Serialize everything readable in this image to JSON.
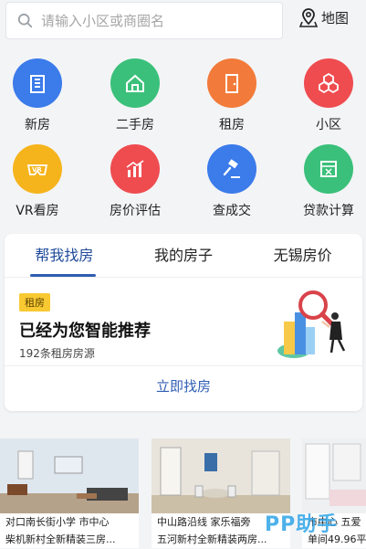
{
  "search": {
    "placeholder": "请输入小区或商圈名"
  },
  "map": {
    "label": "地图"
  },
  "categories": [
    {
      "label": "新房",
      "color": "#3b7bea"
    },
    {
      "label": "二手房",
      "color": "#3ac07a"
    },
    {
      "label": "租房",
      "color": "#f27a3a"
    },
    {
      "label": "小区",
      "color": "#ef4c50"
    },
    {
      "label": "VR看房",
      "color": "#f6b41c"
    },
    {
      "label": "房价评估",
      "color": "#ef4c50"
    },
    {
      "label": "查成交",
      "color": "#3b7bea"
    },
    {
      "label": "贷款计算",
      "color": "#3ac07a"
    }
  ],
  "tabs": [
    "帮我找房",
    "我的房子",
    "无锡房价"
  ],
  "recommend": {
    "tag": "租房",
    "title": "已经为您智能推荐",
    "subtitle": "192条租房房源",
    "button": "立即找房"
  },
  "listings": [
    {
      "line1": "对口南长街小学 市中心",
      "line2": "柴机新村全新精装三房..."
    },
    {
      "line1": "中山路沿线 家乐福旁",
      "line2": "五河新村全新精装两房..."
    },
    {
      "line1": "市中心 五爱",
      "line2": "单间49.96平"
    }
  ],
  "watermark": "PP助手"
}
